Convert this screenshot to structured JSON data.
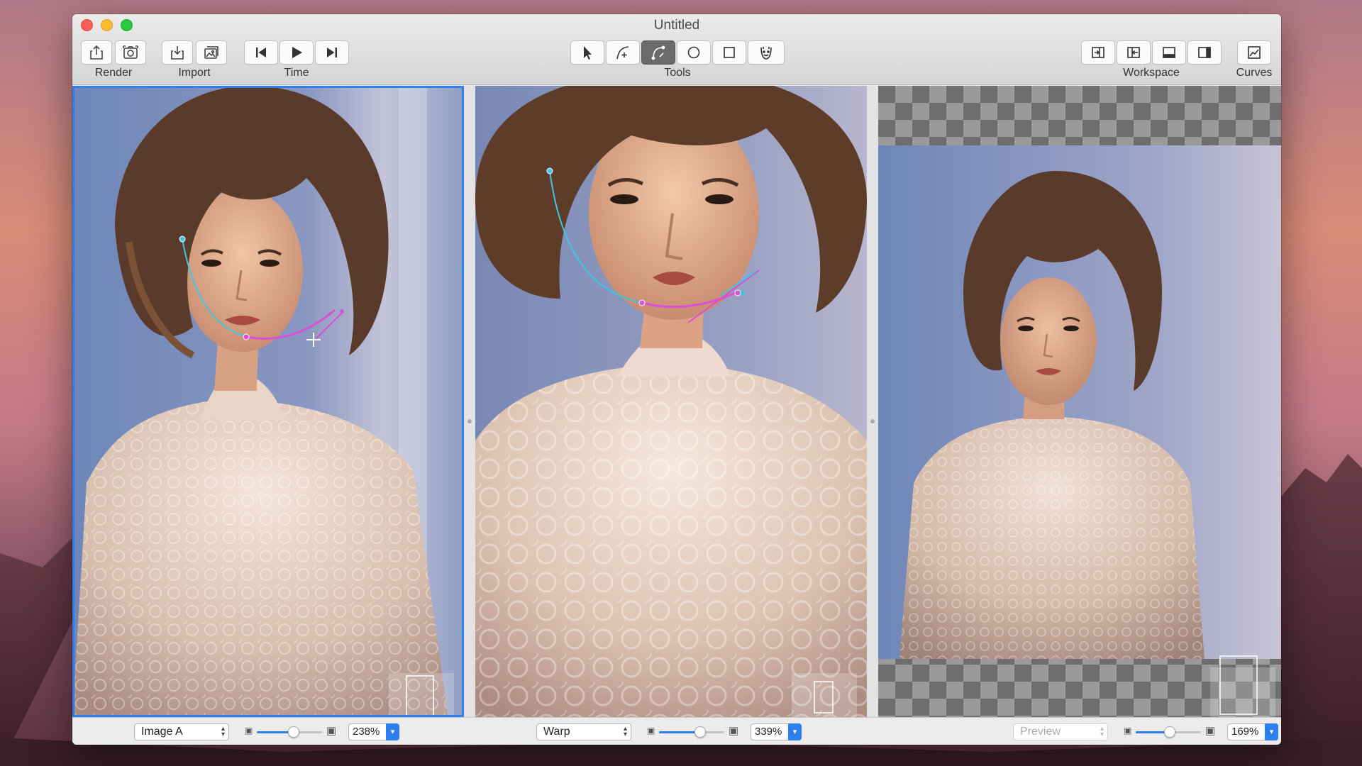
{
  "window": {
    "title": "Untitled"
  },
  "toolbar": {
    "groups": [
      {
        "label": "Render",
        "buttons": [
          "share-icon",
          "camera-icon"
        ]
      },
      {
        "label": "Import",
        "buttons": [
          "import-icon",
          "image-import-icon"
        ]
      },
      {
        "label": "Time",
        "buttons": [
          "skip-back-icon",
          "play-icon",
          "skip-forward-icon"
        ]
      },
      {
        "label": "Tools",
        "buttons": [
          "pointer-icon",
          "add-curve-icon",
          "curve-tool-icon",
          "circle-tool-icon",
          "rectangle-tool-icon",
          "face-tool-icon"
        ],
        "active": "curve-tool-icon"
      },
      {
        "label": "Workspace",
        "buttons": [
          "layout-import-icon",
          "layout-export-icon",
          "bottom-panel-icon",
          "side-panel-icon"
        ]
      },
      {
        "label": "Curves",
        "buttons": [
          "curves-icon"
        ]
      }
    ]
  },
  "panes": [
    {
      "mode": "Image A",
      "zoom": "238%",
      "zoom_fraction": 0.56,
      "enabled": true
    },
    {
      "mode": "Warp",
      "zoom": "339%",
      "zoom_fraction": 0.63,
      "enabled": true
    },
    {
      "mode": "Preview",
      "zoom": "169%",
      "zoom_fraction": 0.52,
      "enabled": false
    }
  ],
  "colors": {
    "accent": "#2d7ff0",
    "curve_cyan": "#3ec7e0",
    "curve_magenta": "#d94fd6"
  }
}
